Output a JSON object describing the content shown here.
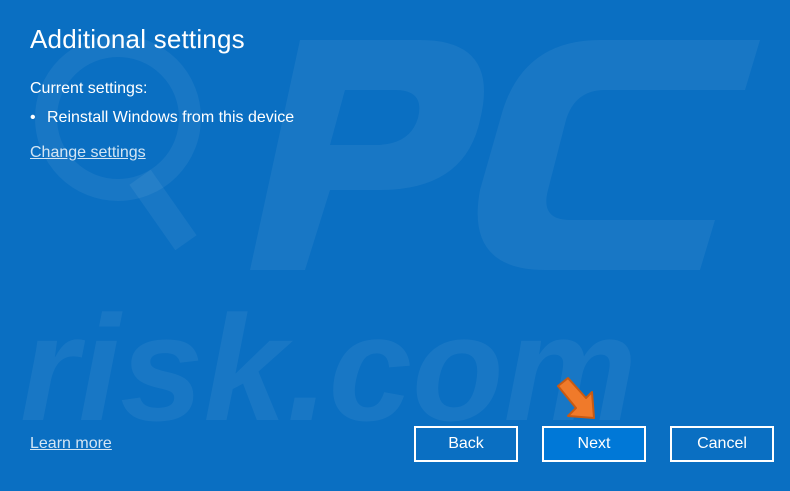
{
  "window": {
    "title": "Additional settings"
  },
  "current_settings": {
    "label": "Current settings:",
    "items": [
      {
        "bullet": "•",
        "text": "Reinstall Windows from this device"
      }
    ],
    "change_link": "Change settings"
  },
  "footer": {
    "learn_more": "Learn more",
    "buttons": {
      "back": "Back",
      "next": "Next",
      "cancel": "Cancel"
    }
  },
  "colors": {
    "background": "#0A6FC2",
    "text": "#FFFFFF",
    "primary_button": "#0078D7",
    "pointer_arrow": "#F07A2A"
  },
  "icons": {
    "pointer": "orange-arrow-pointer-icon"
  }
}
